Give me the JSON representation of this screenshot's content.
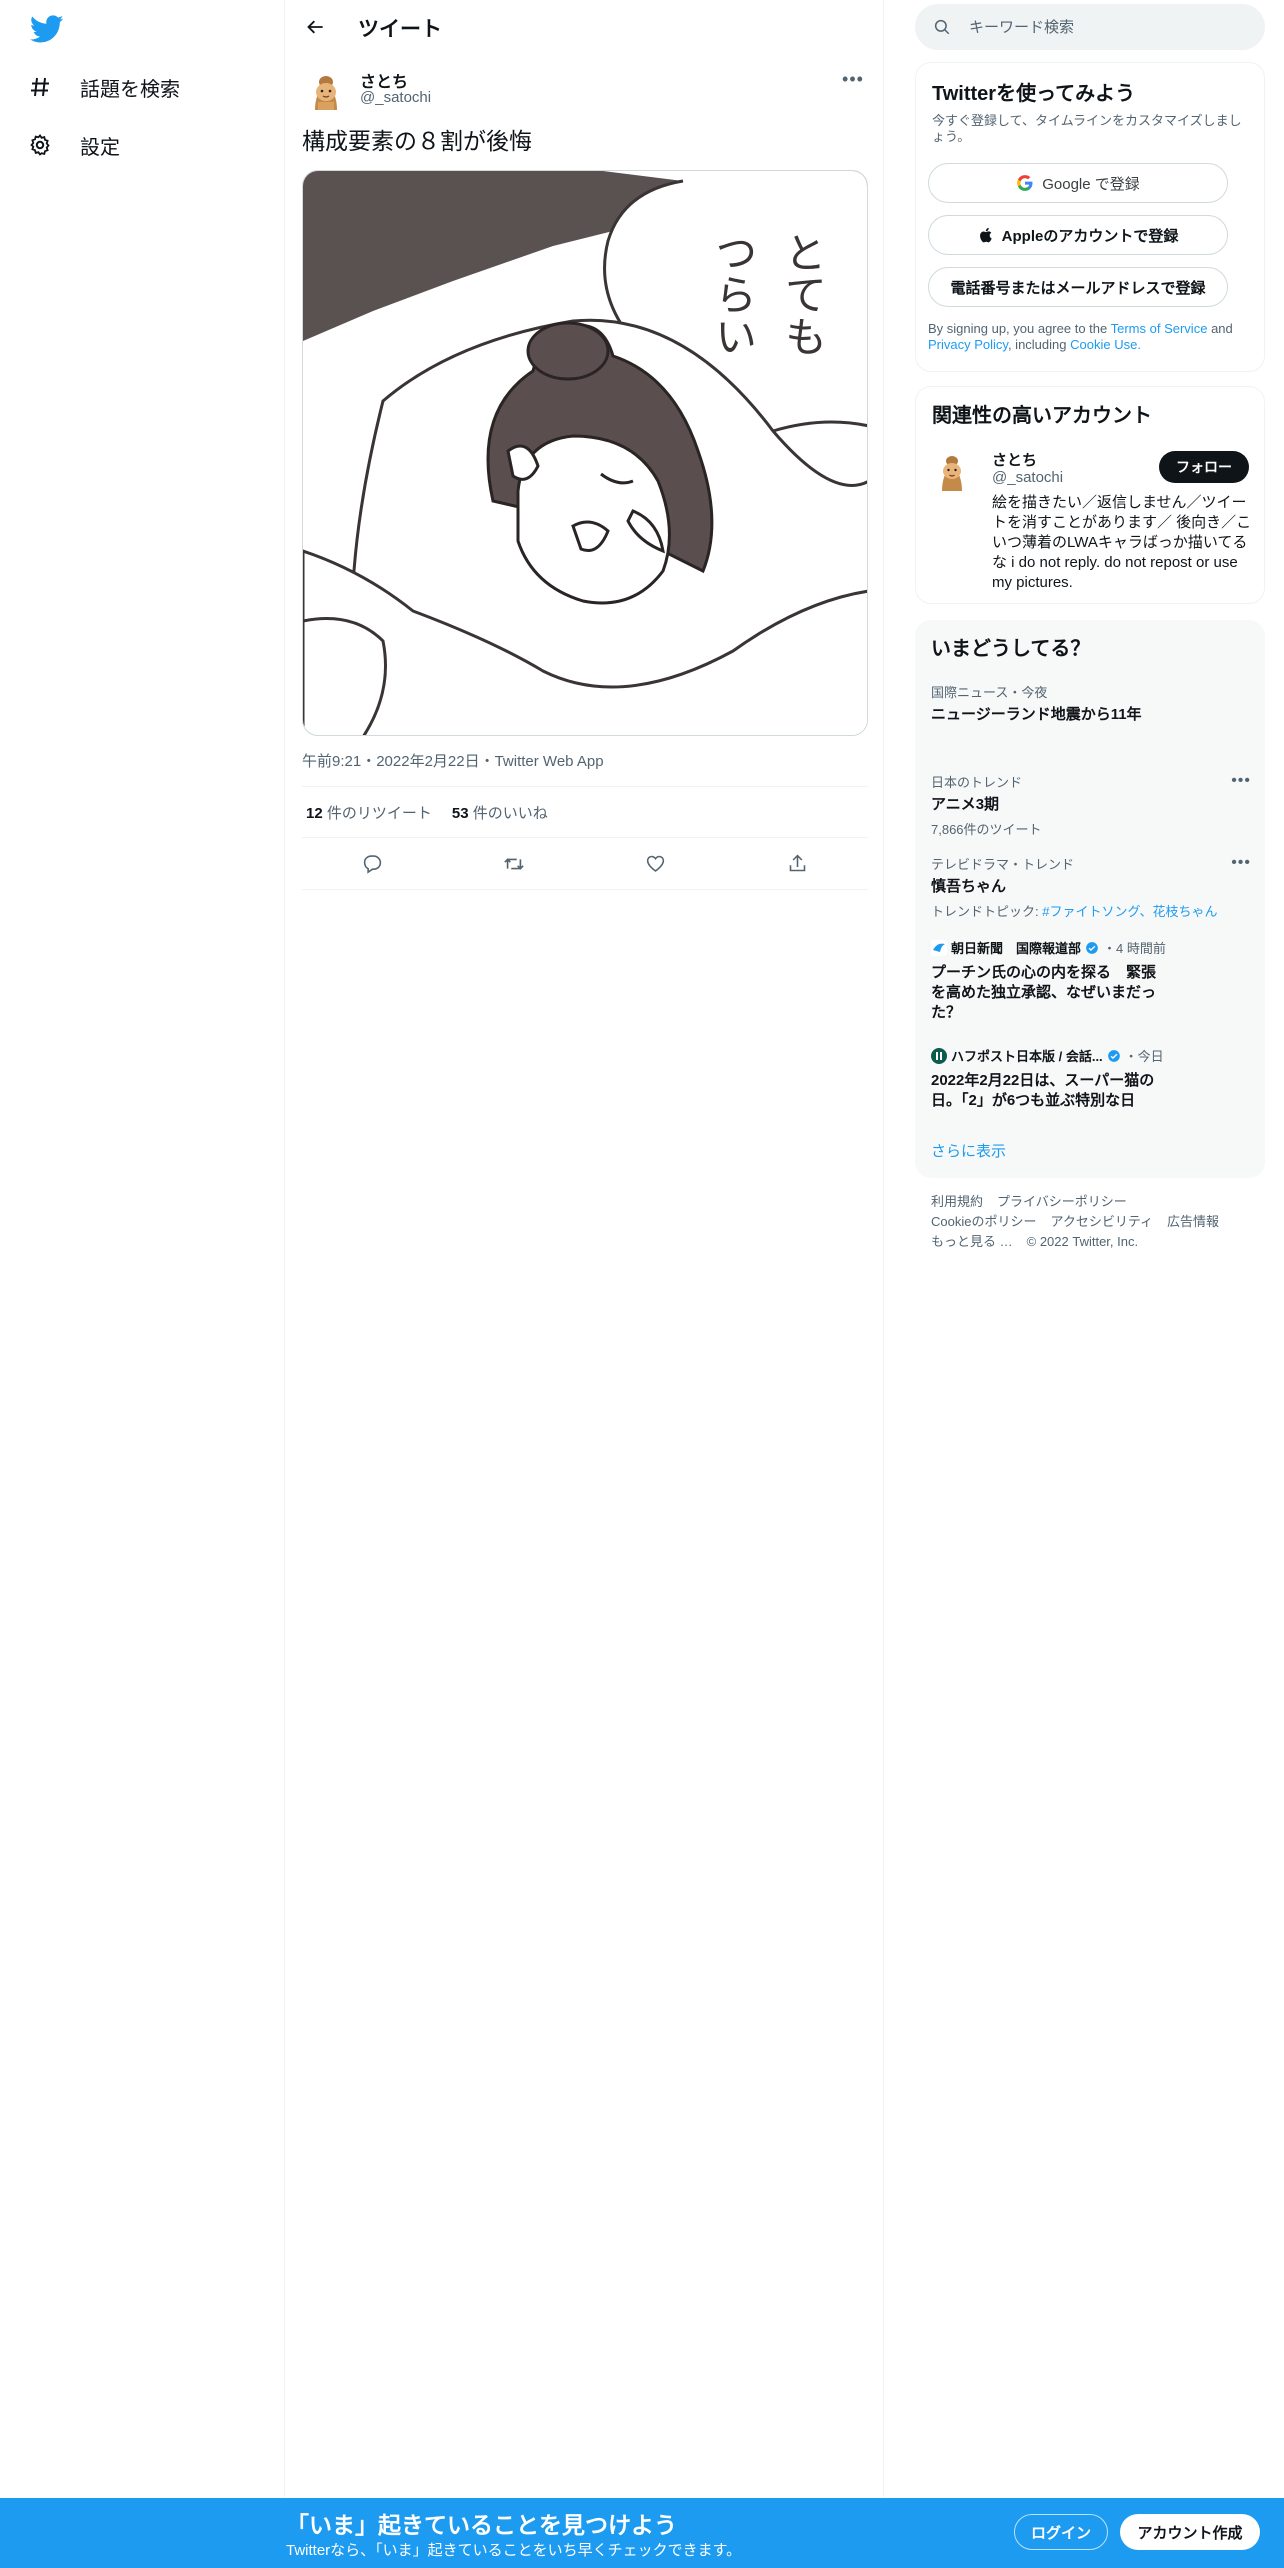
{
  "colors": {
    "accent": "#1d9bf0",
    "text": "#0f1419",
    "muted": "#536471"
  },
  "nav": {
    "logo_icon": "twitter-bird-icon",
    "items": [
      {
        "label": "話題を検索",
        "icon": "hashtag-icon"
      },
      {
        "label": "設定",
        "icon": "gear-icon"
      }
    ]
  },
  "header": {
    "title": "ツイート"
  },
  "tweet": {
    "author_name": "さとち",
    "author_handle": "@_satochi",
    "text": "構成要素の８割が後悔",
    "image_text": "とてもつらい",
    "meta": "午前9:21・2022年2月22日・Twitter Web App",
    "retweets_count": "12",
    "retweets_label": "件のリツイート",
    "likes_count": "53",
    "likes_label": "件のいいね"
  },
  "search": {
    "placeholder": "キーワード検索"
  },
  "signup": {
    "title": "Twitterを使ってみよう",
    "desc": "今すぐ登録して、タイムラインをカスタマイズしましょう。",
    "google": "Google で登録",
    "apple": "Appleのアカウントで登録",
    "phone": "電話番号またはメールアドレスで登録",
    "legal_1": "By signing up, you agree to the",
    "terms": "Terms of Service",
    "legal_2": "and",
    "privacy": "Privacy Policy",
    "legal_3": ", including",
    "cookie": "Cookie Use."
  },
  "related": {
    "title": "関連性の高いアカウント",
    "name": "さとち",
    "handle": "@_satochi",
    "follow": "フォロー",
    "bio": "絵を描きたい／返信しません／ツイートを消すことがあります／ 後向き／こいつ薄着のLWAキャラばっか描いてるな i do not reply. do not repost or use my pictures."
  },
  "trends": {
    "title": "いまどうしてる？",
    "items": [
      {
        "context": "国際ニュース・今夜",
        "topic": "ニュージーランド地震から11年"
      },
      {
        "context": "日本のトレンド",
        "topic": "アニメ3期",
        "sub": "7,866件のツイート"
      },
      {
        "context": "テレビドラマ・トレンド",
        "topic": "慎吾ちゃん",
        "sub_prefix": "トレンドトピック: ",
        "sub_link": "#ファイトソング、花枝ちゃん"
      }
    ],
    "news": [
      {
        "source": "朝日新聞　国際報道部",
        "time": "・4 時間前",
        "headline": "プーチン氏の心の内を探る　緊張を高めた独立承認、なぜいまだった？"
      },
      {
        "source": "ハフポスト日本版 / 会話...",
        "time": "・今日",
        "headline": "2022年2月22日は、スーパー猫の日。「2」が6つも並ぶ特別な日"
      }
    ],
    "show_more": "さらに表示"
  },
  "footer": {
    "links": [
      "利用規約",
      "プライバシーポリシー",
      "Cookieのポリシー",
      "アクセシビリティ",
      "広告情報",
      "もっと見る …",
      "© 2022 Twitter, Inc."
    ]
  },
  "bottom_bar": {
    "title": "「いま」起きていることを見つけよう",
    "subtitle": "Twitterなら、「いま」起きていることをいち早くチェックできます。",
    "login": "ログイン",
    "signup": "アカウント作成"
  }
}
